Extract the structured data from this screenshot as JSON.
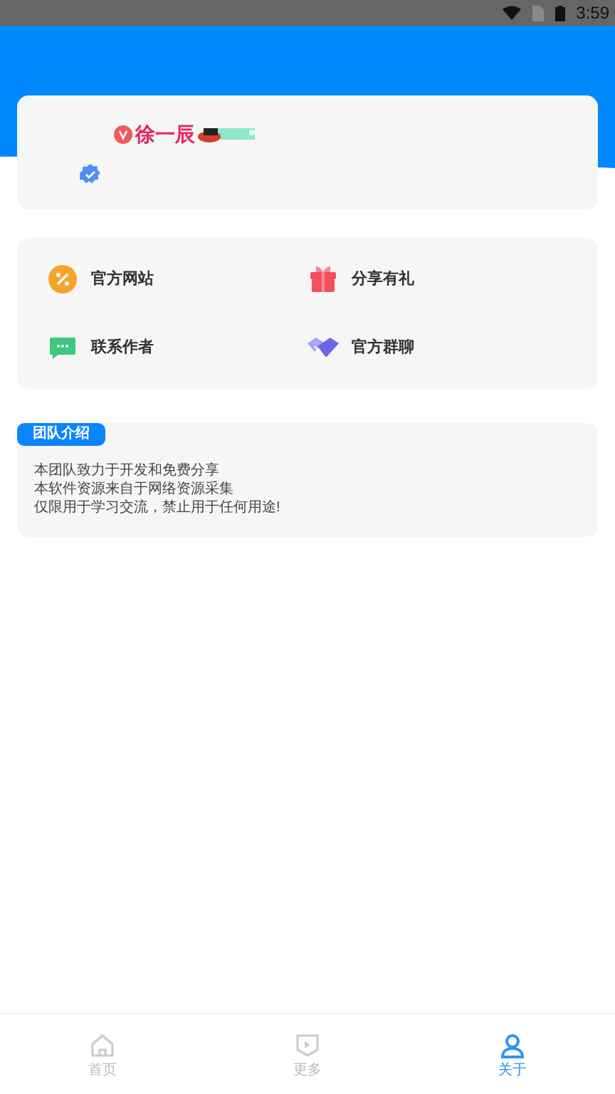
{
  "status_bar": {
    "time": "3:59"
  },
  "profile": {
    "name": "徐一辰",
    "vip": true,
    "verified": true
  },
  "menu": [
    {
      "label": "官方网站",
      "kind": "website"
    },
    {
      "label": "分享有礼",
      "kind": "gift"
    },
    {
      "label": "联系作者",
      "kind": "chat"
    },
    {
      "label": "官方群聊",
      "kind": "group"
    }
  ],
  "team": {
    "badge": "团队介绍",
    "lines": [
      "本团队致力于开发和免费分享",
      "本软件资源来自于网络资源采集",
      "仅限用于学习交流，禁止用于任何用途!"
    ]
  },
  "nav": [
    {
      "label": "首页",
      "kind": "home",
      "selected": false
    },
    {
      "label": "更多",
      "kind": "more",
      "selected": false
    },
    {
      "label": "关于",
      "kind": "about",
      "selected": true
    }
  ]
}
